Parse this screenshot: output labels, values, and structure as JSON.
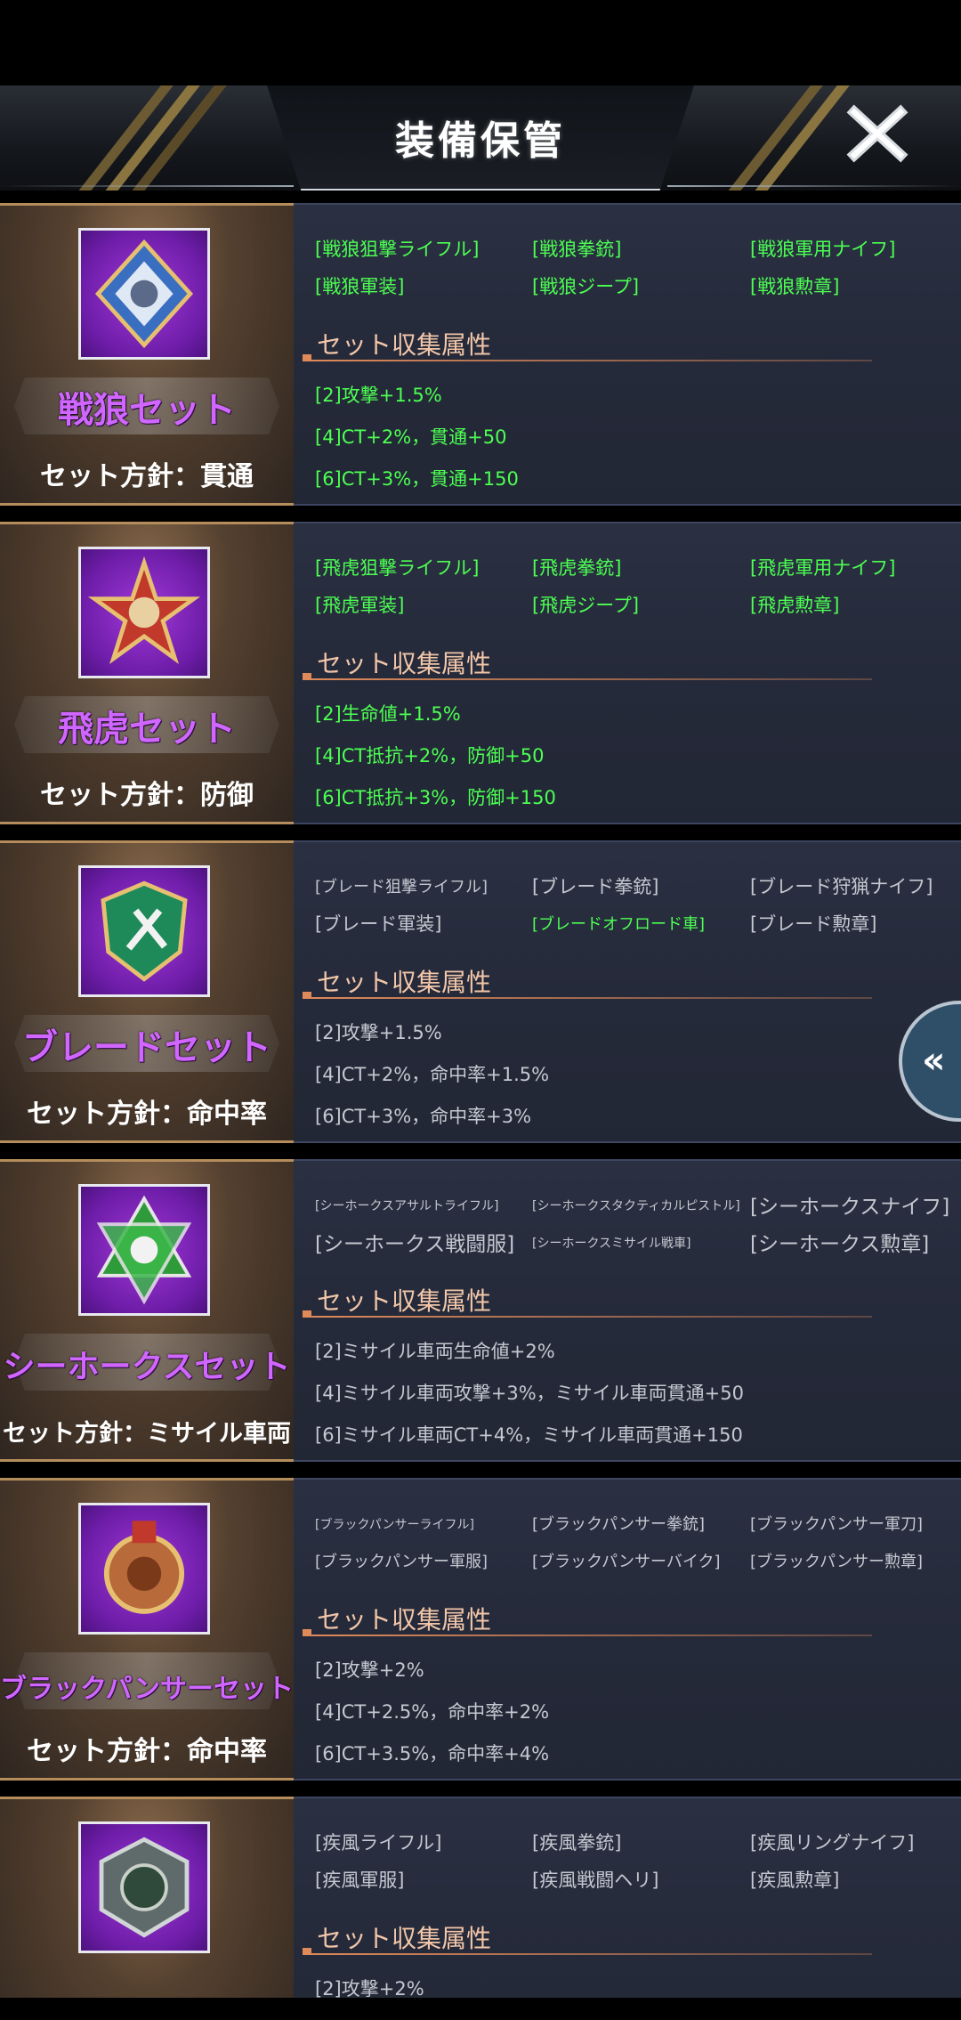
{
  "header": {
    "title": "装備保管"
  },
  "section_label": "セット収集属性",
  "sets": [
    {
      "name": "戦狼セット",
      "policy": "セット方針：貫通",
      "equips": [
        {
          "label": "[戦狼狙撃ライフル]",
          "active": true
        },
        {
          "label": "[戦狼拳銃]",
          "active": true
        },
        {
          "label": "[戦狼軍用ナイフ]",
          "active": true
        },
        {
          "label": "[戦狼軍装]",
          "active": true
        },
        {
          "label": "[戦狼ジープ]",
          "active": true
        },
        {
          "label": "[戦狼勲章]",
          "active": true
        }
      ],
      "attrs": [
        {
          "label": "[2]攻撃+1.5%",
          "active": true
        },
        {
          "label": "[4]CT+2%，貫通+50",
          "active": true
        },
        {
          "label": "[6]CT+3%，貫通+150",
          "active": true
        }
      ]
    },
    {
      "name": "飛虎セット",
      "policy": "セット方針：防御",
      "equips": [
        {
          "label": "[飛虎狙撃ライフル]",
          "active": true
        },
        {
          "label": "[飛虎拳銃]",
          "active": true
        },
        {
          "label": "[飛虎軍用ナイフ]",
          "active": true
        },
        {
          "label": "[飛虎軍装]",
          "active": true
        },
        {
          "label": "[飛虎ジープ]",
          "active": true
        },
        {
          "label": "[飛虎勲章]",
          "active": true
        }
      ],
      "attrs": [
        {
          "label": "[2]生命値+1.5%",
          "active": true
        },
        {
          "label": "[4]CT抵抗+2%，防御+50",
          "active": true
        },
        {
          "label": "[6]CT抵抗+3%，防御+150",
          "active": true
        }
      ]
    },
    {
      "name": "ブレードセット",
      "policy": "セット方針：命中率",
      "equips": [
        {
          "label": "[ブレード狙撃ライフル]",
          "active": false
        },
        {
          "label": "[ブレード拳銃]",
          "active": false
        },
        {
          "label": "[ブレード狩猟ナイフ]",
          "active": false
        },
        {
          "label": "[ブレード軍装]",
          "active": false
        },
        {
          "label": "[ブレードオフロード車]",
          "active": true
        },
        {
          "label": "[ブレード勲章]",
          "active": false
        }
      ],
      "attrs": [
        {
          "label": "[2]攻撃+1.5%",
          "active": false
        },
        {
          "label": "[4]CT+2%，命中率+1.5%",
          "active": false
        },
        {
          "label": "[6]CT+3%，命中率+3%",
          "active": false
        }
      ]
    },
    {
      "name": "シーホークスセット",
      "policy": "セット方針：ミサイル車両",
      "equips": [
        {
          "label": "[シーホークスアサルトライフル]",
          "active": false
        },
        {
          "label": "[シーホークスタクティカルピストル]",
          "active": false
        },
        {
          "label": "[シーホークスナイフ]",
          "active": false
        },
        {
          "label": "[シーホークス戦闘服]",
          "active": false
        },
        {
          "label": "[シーホークスミサイル戦車]",
          "active": false
        },
        {
          "label": "[シーホークス勲章]",
          "active": false
        }
      ],
      "attrs": [
        {
          "label": "[2]ミサイル車両生命値+2%",
          "active": false
        },
        {
          "label": "[4]ミサイル車両攻撃+3%，ミサイル車両貫通+50",
          "active": false
        },
        {
          "label": "[6]ミサイル車両CT+4%，ミサイル車両貫通+150",
          "active": false
        }
      ]
    },
    {
      "name": "ブラックパンサーセット",
      "policy": "セット方針：命中率",
      "equips": [
        {
          "label": "[ブラックパンサーライフル]",
          "active": false
        },
        {
          "label": "[ブラックパンサー拳銃]",
          "active": false
        },
        {
          "label": "[ブラックパンサー軍刀]",
          "active": false
        },
        {
          "label": "[ブラックパンサー軍服]",
          "active": false
        },
        {
          "label": "[ブラックパンサーバイク]",
          "active": false
        },
        {
          "label": "[ブラックパンサー勲章]",
          "active": false
        }
      ],
      "attrs": [
        {
          "label": "[2]攻撃+2%",
          "active": false
        },
        {
          "label": "[4]CT+2.5%，命中率+2%",
          "active": false
        },
        {
          "label": "[6]CT+3.5%，命中率+4%",
          "active": false
        }
      ]
    },
    {
      "name": "",
      "policy": "",
      "equips": [
        {
          "label": "[疾風ライフル]",
          "active": false
        },
        {
          "label": "[疾風拳銃]",
          "active": false
        },
        {
          "label": "[疾風リングナイフ]",
          "active": false
        },
        {
          "label": "[疾風軍服]",
          "active": false
        },
        {
          "label": "[疾風戦闘ヘリ]",
          "active": false
        },
        {
          "label": "[疾風勲章]",
          "active": false
        }
      ],
      "attrs": [
        {
          "label": "[2]攻撃+2%",
          "active": false
        }
      ]
    }
  ],
  "colors": {
    "active": "#4cff52",
    "inactive": "#c4c8d0",
    "set_name": "#d066ff",
    "section": "#f2c6a8"
  },
  "icons": {
    "close": "close-icon",
    "expand": "chevron-left-double-icon"
  }
}
